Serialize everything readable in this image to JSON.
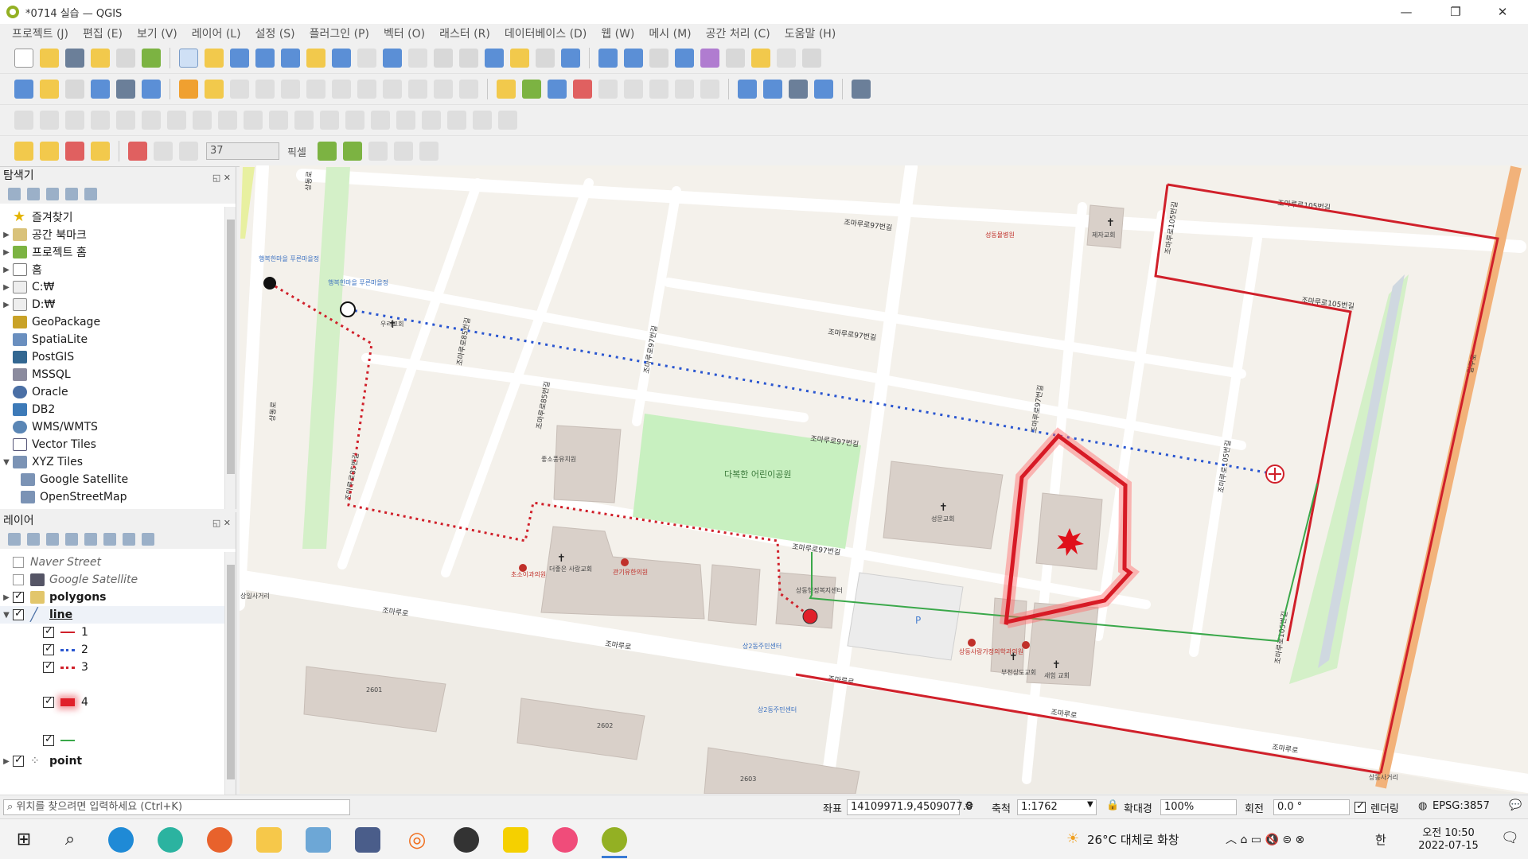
{
  "window": {
    "title": "*0714 실습 — QGIS",
    "controls": [
      "—",
      "❐",
      "✕"
    ]
  },
  "menu": [
    "프로젝트 (J)",
    "편집 (E)",
    "보기 (V)",
    "레이어 (L)",
    "설정 (S)",
    "플러그인 (P)",
    "벡터 (O)",
    "래스터 (R)",
    "데이터베이스 (D)",
    "웹 (W)",
    "메시 (M)",
    "공간 처리 (C)",
    "도움말 (H)"
  ],
  "digitizing": {
    "tolerance_value": "37",
    "tolerance_unit": "픽셀"
  },
  "browser_panel": {
    "title": "탐색기",
    "items": [
      {
        "label": "즐겨찾기",
        "icon": "star-icon"
      },
      {
        "label": "공간 북마크",
        "icon": "bookmark-icon"
      },
      {
        "label": "프로젝트 홈",
        "icon": "project-home-icon"
      },
      {
        "label": "홈",
        "icon": "home-icon"
      },
      {
        "label": "C:₩",
        "icon": "drive-icon"
      },
      {
        "label": "D:₩",
        "icon": "drive-icon"
      },
      {
        "label": "GeoPackage",
        "icon": "geopackage-icon"
      },
      {
        "label": "SpatiaLite",
        "icon": "spatialite-icon"
      },
      {
        "label": "PostGIS",
        "icon": "postgis-icon"
      },
      {
        "label": "MSSQL",
        "icon": "mssql-icon"
      },
      {
        "label": "Oracle",
        "icon": "oracle-icon"
      },
      {
        "label": "DB2",
        "icon": "db2-icon"
      },
      {
        "label": "WMS/WMTS",
        "icon": "wms-icon"
      },
      {
        "label": "Vector Tiles",
        "icon": "vector-tiles-icon"
      },
      {
        "label": "XYZ Tiles",
        "icon": "xyz-tiles-icon"
      },
      {
        "label": "Google Satellite",
        "icon": "xyz-tile-icon"
      },
      {
        "label": "OpenStreetMap",
        "icon": "xyz-tile-icon"
      }
    ]
  },
  "layers_panel": {
    "title": "레이어",
    "layers": {
      "naver_street": "Naver Street",
      "google_satellite": "Google Satellite",
      "polygons": "polygons",
      "line": "line",
      "line_cat_1": "1",
      "line_cat_2": "2",
      "line_cat_3": "3",
      "line_cat_4": "4",
      "point": "point"
    }
  },
  "status": {
    "locator_placeholder": "위치를 찾으려면 입력하세요 (Ctrl+K)",
    "coord_label": "좌표",
    "coord_value": "14109971.9,4509077.8",
    "scale_label": "축척",
    "scale_value": "1:1762",
    "magnifier_label": "확대경",
    "magnifier_value": "100%",
    "rotation_label": "회전",
    "rotation_value": "0.0 °",
    "render_label": "렌더링",
    "crs": "EPSG:3857"
  },
  "map": {
    "roads": {
      "r97a": "조마루로97번길",
      "r97b": "조마루로97번길",
      "r97c": "조마루로97번길",
      "r97d": "조마루로97번길",
      "r105a": "조마루로105번길",
      "r105b": "조마루로105번길",
      "r105c": "조마루로105번길",
      "r105d": "조마루로105번길",
      "r105e": "조마루로105번길",
      "r85a": "조마루로85번길",
      "r85b": "조마루로85번길",
      "r85c": "조마루로85번길",
      "r97e": "조마루로97번길",
      "r97f": "조마루로97번길",
      "jomaru1": "조마루로",
      "jomaru2": "조마루로",
      "jomaru3": "조마루로",
      "jomaru4": "조마루로",
      "jomaru5": "조마루로",
      "sangdong1": "상동로",
      "sangdong2": "상동로",
      "gilju": "길주로"
    },
    "pois": {
      "church_uri": "우리교회",
      "church_jeil": "제자교회",
      "church_seongmun": "성문교회",
      "church_sarang": "더좋은 사랑교회",
      "church_bucheon": "부천상도교회",
      "church_saeim": "새힘 교회",
      "park": "다복한 어린이공원",
      "clinic1": "성동물병원",
      "clinic2": "초소이과의원",
      "clinic3": "관기유한의원",
      "clinic4": "상동사랑가정의학과의원",
      "office": "상동행정복지센터",
      "center1": "상2동주민센터",
      "center2": "상2동주민센터",
      "bus1": "행복한마을 푸른마을정",
      "bus2": "행복한마을 푸른마을정",
      "daycare": "좋소풍유치원",
      "block1": "2601",
      "block2": "2602",
      "block3": "2603",
      "gate": "상일사거리",
      "crossing": "상동사거리"
    }
  },
  "taskbar": {
    "weather": "26°C 대체로 화창",
    "ime": "한",
    "time": "오전 10:50",
    "date": "2022-07-15"
  }
}
